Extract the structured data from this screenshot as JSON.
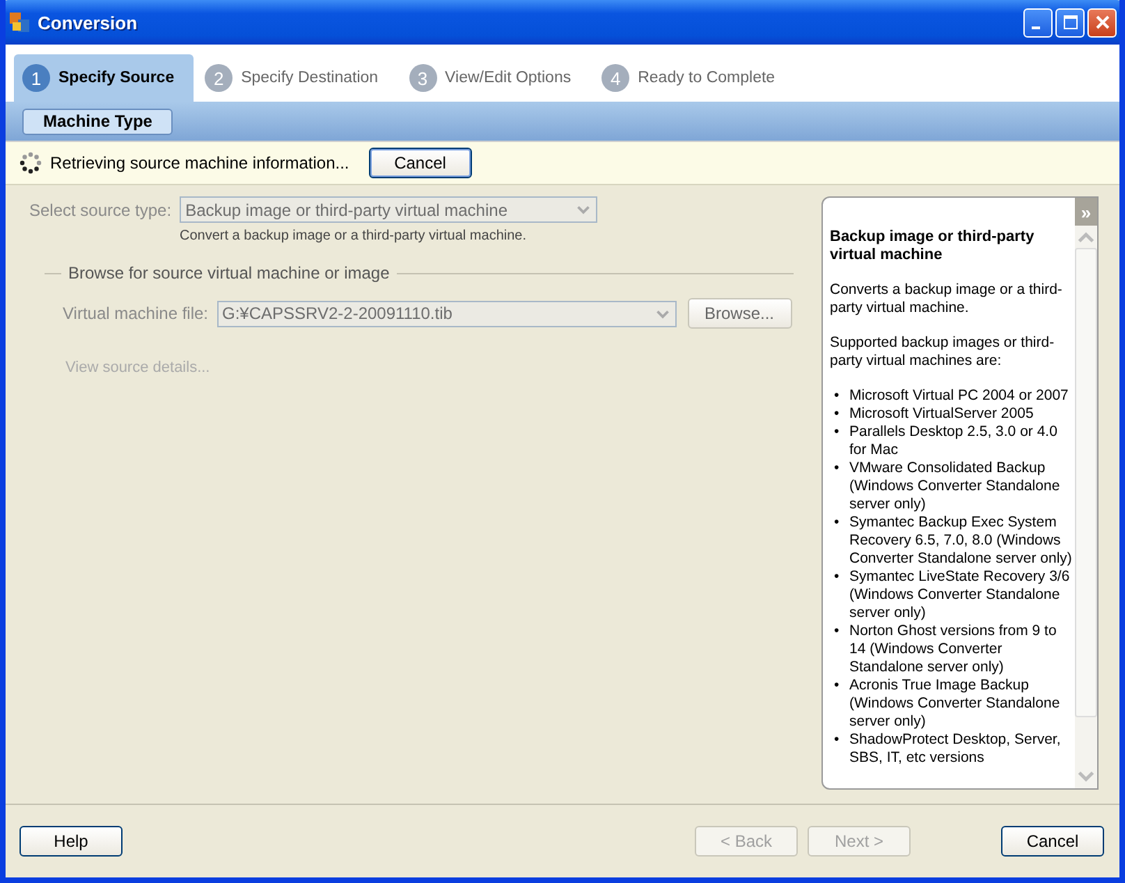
{
  "window": {
    "title": "Conversion"
  },
  "steps": [
    {
      "number": "1",
      "label": "Specify Source",
      "selected": true
    },
    {
      "number": "2",
      "label": "Specify Destination",
      "selected": false
    },
    {
      "number": "3",
      "label": "View/Edit Options",
      "selected": false
    },
    {
      "number": "4",
      "label": "Ready to Complete",
      "selected": false
    }
  ],
  "subtabs": [
    {
      "label": "Machine Type",
      "selected": true
    }
  ],
  "status": {
    "message": "Retrieving source machine information...",
    "cancel": "Cancel"
  },
  "form": {
    "source_type_label": "Select source type:",
    "source_type_value": "Backup image or third-party virtual machine",
    "source_type_disabled": true,
    "source_type_hint": "Convert a backup image or a third-party virtual machine.",
    "group_title": "Browse for source virtual machine or image",
    "file_label": "Virtual machine file:",
    "file_value": "G:¥CAPSSRV2-2-20091110.tib",
    "file_disabled": true,
    "browse": "Browse...",
    "details_link": "View source details...",
    "details_disabled": true
  },
  "help": {
    "collapse": "»",
    "title": "Backup image or third-party virtual machine",
    "paragraphs": [
      "Converts a backup image or a third-party virtual machine.",
      "Supported backup images or third-party virtual machines are:"
    ],
    "bullet": "•",
    "items": [
      "Microsoft Virtual PC 2004 or 2007",
      "Microsoft VirtualServer 2005",
      "Parallels Desktop 2.5, 3.0 or 4.0 for Mac",
      "VMware Consolidated Backup (Windows Converter Standalone server only)",
      "Symantec Backup Exec System Recovery 6.5, 7.0, 8.0 (Windows Converter Standalone server only)",
      "Symantec LiveState Recovery 3/6 (Windows Converter Standalone server only)",
      "Norton Ghost versions from 9 to 14 (Windows Converter Standalone server only)",
      "Acronis True Image Backup (Windows Converter Standalone server only)",
      "ShadowProtect Desktop, Server, SBS, IT, etc versions"
    ]
  },
  "footer": {
    "help": {
      "label": "Help",
      "disabled": false
    },
    "back": {
      "label": "< Back",
      "disabled": true
    },
    "next": {
      "label": "Next >",
      "disabled": true
    },
    "cancel": {
      "label": "Cancel",
      "disabled": false
    }
  }
}
